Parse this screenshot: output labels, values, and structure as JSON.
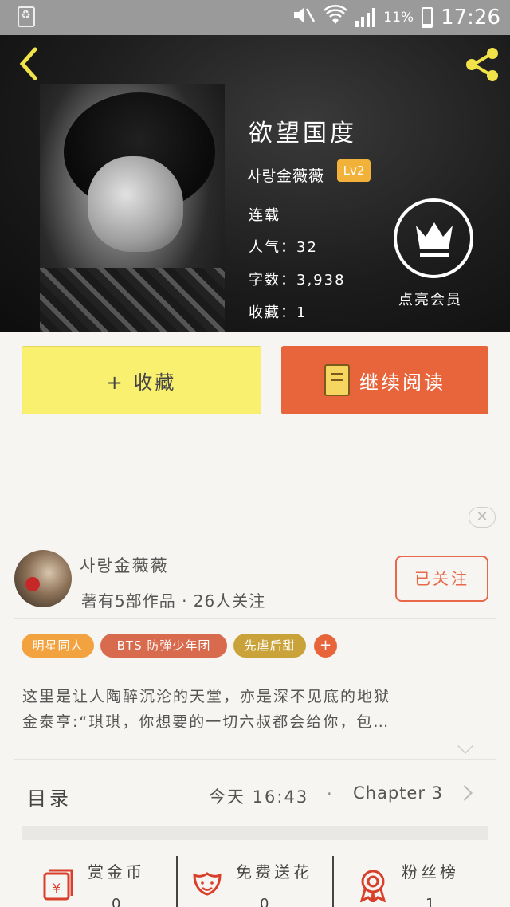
{
  "status_bar": {
    "battery_pct": "11%",
    "time": "17:26"
  },
  "book": {
    "title": "欲望国度",
    "author": "사랑金薇薇",
    "level": "Lv2",
    "status": "连载",
    "popularity": "人气：32",
    "word_count": "字数：3,938",
    "favorites": "收藏：1",
    "member_label": "点亮会员"
  },
  "actions": {
    "favorite_label": "+ 收藏",
    "continue_label": "继续阅读"
  },
  "author_card": {
    "name": "사랑金薇薇",
    "stats": "著有5部作品 · 26人关注",
    "follow_label": "已关注"
  },
  "tags": [
    {
      "label": "明星同人",
      "color": "#f2a23e"
    },
    {
      "label": "BTS  防弹少年团",
      "color": "#d86a4d"
    },
    {
      "label": "先虐后甜",
      "color": "#c9a33a"
    }
  ],
  "tag_add": "+",
  "description": {
    "line1": "这里是让人陶醉沉沦的天堂，亦是深不见底的地狱",
    "line2": "金泰亨:“琪琪，你想要的一切六叔都会给你，包…"
  },
  "toc": {
    "label": "目录",
    "updated": "今天 16:43",
    "separator": "·",
    "latest": "Chapter 3"
  },
  "bottom_actions": [
    {
      "label": "赏金币",
      "count": "0",
      "icon": "coin-icon"
    },
    {
      "label": "免费送花",
      "count": "0",
      "icon": "flower-icon"
    },
    {
      "label": "粉丝榜",
      "count": "1",
      "icon": "ribbon-icon"
    }
  ],
  "colors": {
    "accent_orange": "#e8653c",
    "accent_yellow": "#f9f06f",
    "icon_red": "#d9402b"
  }
}
